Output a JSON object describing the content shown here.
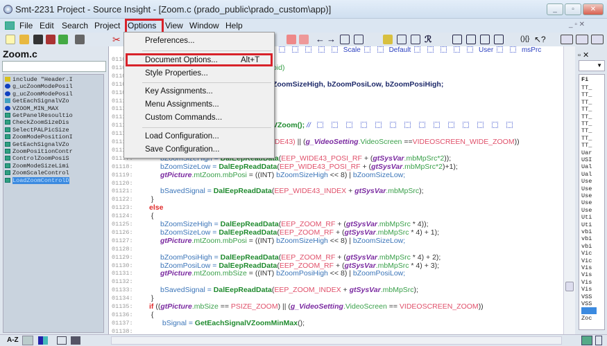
{
  "window": {
    "title": "Smt-2231 Project - Source Insight - [Zoom.c (prado_public\\prado_custom\\app)]",
    "minimize": "_",
    "restore": "▫",
    "close": "✕"
  },
  "menubar": {
    "items": [
      "File",
      "Edit",
      "Search",
      "Project",
      "Options",
      "View",
      "Window",
      "Help"
    ],
    "highlighted": "Options",
    "highlight_color": "#d8222a"
  },
  "options_menu": {
    "items": [
      {
        "label": "Preferences...",
        "shortcut": ""
      },
      {
        "label": "Document Options...",
        "shortcut": "Alt+T",
        "highlighted": true
      },
      {
        "label": "Style Properties...",
        "shortcut": ""
      },
      {
        "label": "Key Assignments...",
        "shortcut": ""
      },
      {
        "label": "Menu Assignments...",
        "shortcut": ""
      },
      {
        "label": "Custom Commands...",
        "shortcut": ""
      },
      {
        "label": "Load Configuration...",
        "shortcut": ""
      },
      {
        "label": "Save Configuration...",
        "shortcut": ""
      }
    ]
  },
  "symbol_bar": {
    "labels": [
      "Scale",
      "Default",
      "User",
      "msPrc"
    ]
  },
  "left_panel": {
    "file_name": "Zoom.c",
    "search_value": "",
    "symbols": [
      {
        "name": "include \"Header.I",
        "icon": "include-icon"
      },
      {
        "name": "g_ucZoomModePosil",
        "icon": "variable-icon"
      },
      {
        "name": "g_ucZoomModePosil",
        "icon": "variable-icon"
      },
      {
        "name": "GetEachSignalVZo",
        "icon": "prototype-icon"
      },
      {
        "name": "VZOOM_MIN_MAX",
        "icon": "variable-icon"
      },
      {
        "name": "GetPanelResoultio",
        "icon": "function-icon"
      },
      {
        "name": "CheckZoomSizeDis",
        "icon": "function-icon"
      },
      {
        "name": "SelectPALPicSize",
        "icon": "function-icon"
      },
      {
        "name": "ZoomModePositionI",
        "icon": "function-icon"
      },
      {
        "name": "GetEachSignalVZo",
        "icon": "function-icon"
      },
      {
        "name": "ZoomPositionContr",
        "icon": "function-icon"
      },
      {
        "name": "ControlZoomPosiS",
        "icon": "function-icon"
      },
      {
        "name": "ZoomModeSizeLimi",
        "icon": "function-icon"
      },
      {
        "name": "ZoomScaleControl",
        "icon": "function-icon"
      },
      {
        "name": "LoadZoomControlD",
        "icon": "function-icon",
        "selected": true
      }
    ],
    "sort_label": "A-Z"
  },
  "code": {
    "lines": [
      {
        "n": "01105:",
        "segs": []
      },
      {
        "n": "01106:",
        "partial": true,
        "segs": [
          [
            "m",
            "oid)"
          ]
        ]
      },
      {
        "n": "01107:",
        "segs": []
      },
      {
        "n": "01108:",
        "partial": true,
        "segs": [
          [
            "b",
            "ZoomSizeHigh, bZoomPosiLow, bZoomPosiHigh;"
          ]
        ]
      },
      {
        "n": "01109:",
        "segs": []
      },
      {
        "n": "01110:",
        "segs": []
      },
      {
        "n": "01111:",
        "segs": []
      },
      {
        "n": "01112:",
        "segs": []
      },
      {
        "n": "01113:",
        "partial": true,
        "segs": [
          [
            "f",
            "VZoom(); "
          ],
          [
            "cm",
            "// "
          ]
        ],
        "comment_glyphs": 14
      },
      {
        "n": "01114:",
        "segs": []
      },
      {
        "n": "01115:",
        "partial": true,
        "segs": [
          [
            "c",
            "IDE43)"
          ],
          [
            "p",
            " || ("
          ],
          [
            "g",
            "g_VideoSetting"
          ],
          [
            "m",
            ".VideoScreen "
          ],
          [
            "p",
            "=="
          ],
          [
            "c",
            "VIDEOSCREEN_WIDE_ZOOM"
          ],
          [
            "p",
            "))"
          ]
        ]
      },
      {
        "n": "01116:",
        "segs": []
      },
      {
        "n": "01117:",
        "indent": 1,
        "segs": [
          [
            "v",
            "bZoomSizeHigh = "
          ],
          [
            "f",
            "DalEepReadData"
          ],
          [
            "p",
            "("
          ],
          [
            "c",
            "EEP_WIDE43_POSI_RF"
          ],
          [
            "p",
            " + ("
          ],
          [
            "g",
            "gtSysVar"
          ],
          [
            "m",
            ".mbMpSrc*2"
          ],
          [
            "p",
            "));"
          ]
        ]
      },
      {
        "n": "01118:",
        "indent": 1,
        "segs": [
          [
            "v",
            "bZoomSizeLow = "
          ],
          [
            "f",
            "DalEepReadData"
          ],
          [
            "p",
            "("
          ],
          [
            "c",
            "EEP_WIDE43_POSI_RF"
          ],
          [
            "p",
            " + ("
          ],
          [
            "g",
            "gtSysVar"
          ],
          [
            "m",
            ".mbMpSrc*2"
          ],
          [
            "p",
            ")+1);"
          ]
        ]
      },
      {
        "n": "01119:",
        "indent": 1,
        "segs": [
          [
            "g",
            "gtPicture"
          ],
          [
            "m",
            ".mtZoom.mbPosi"
          ],
          [
            "p",
            " = ((INT) "
          ],
          [
            "v",
            "bZoomSizeHigh"
          ],
          [
            "p",
            " << 8) | "
          ],
          [
            "v",
            "bZoomSizeLow;"
          ]
        ]
      },
      {
        "n": "01120:",
        "segs": []
      },
      {
        "n": "01121:",
        "indent": 1,
        "segs": [
          [
            "v",
            "bSavedSignal = "
          ],
          [
            "f",
            "DalEepReadData"
          ],
          [
            "p",
            "("
          ],
          [
            "c",
            "EEP_WIDE43_INDEX"
          ],
          [
            "p",
            " + "
          ],
          [
            "g",
            "gtSysVar"
          ],
          [
            "m",
            ".mbMpSrc"
          ],
          [
            "p",
            ");"
          ]
        ]
      },
      {
        "n": "01122:",
        "indent": 0,
        "segs": [
          [
            "p",
            " }"
          ]
        ]
      },
      {
        "n": "01123:",
        "indent": 0,
        "segs": [
          [
            "k",
            "else"
          ]
        ]
      },
      {
        "n": "01124:",
        "indent": 0,
        "segs": [
          [
            "p",
            " {"
          ]
        ]
      },
      {
        "n": "01125:",
        "indent": 1,
        "segs": [
          [
            "v",
            "bZoomSizeHigh = "
          ],
          [
            "f",
            "DalEepReadData"
          ],
          [
            "p",
            "("
          ],
          [
            "c",
            "EEP_ZOOM_RF"
          ],
          [
            "p",
            " + ("
          ],
          [
            "g",
            "gtSysVar"
          ],
          [
            "m",
            ".mbMpSrc"
          ],
          [
            "p",
            " * 4));"
          ]
        ]
      },
      {
        "n": "01126:",
        "indent": 1,
        "segs": [
          [
            "v",
            "bZoomSizeLow = "
          ],
          [
            "f",
            "DalEepReadData"
          ],
          [
            "p",
            "("
          ],
          [
            "c",
            "EEP_ZOOM_RF"
          ],
          [
            "p",
            " + ("
          ],
          [
            "g",
            "gtSysVar"
          ],
          [
            "m",
            ".mbMpSrc"
          ],
          [
            "p",
            " * 4) + 1);"
          ]
        ]
      },
      {
        "n": "01127:",
        "indent": 1,
        "segs": [
          [
            "g",
            "gtPicture"
          ],
          [
            "m",
            ".mtZoom.mbPosi"
          ],
          [
            "p",
            " = ((INT) "
          ],
          [
            "v",
            "bZoomSizeHigh"
          ],
          [
            "p",
            " << 8) | "
          ],
          [
            "v",
            "bZoomSizeLow;"
          ]
        ]
      },
      {
        "n": "01128:",
        "segs": []
      },
      {
        "n": "01129:",
        "indent": 1,
        "segs": [
          [
            "v",
            "bZoomPosiHigh = "
          ],
          [
            "f",
            "DalEepReadData"
          ],
          [
            "p",
            "("
          ],
          [
            "c",
            "EEP_ZOOM_RF"
          ],
          [
            "p",
            " + ("
          ],
          [
            "g",
            "gtSysVar"
          ],
          [
            "m",
            ".mbMpSrc"
          ],
          [
            "p",
            " * 4) + 2);"
          ]
        ]
      },
      {
        "n": "01130:",
        "indent": 1,
        "segs": [
          [
            "v",
            "bZoomPosiLow = "
          ],
          [
            "f",
            "DalEepReadData"
          ],
          [
            "p",
            "("
          ],
          [
            "c",
            "EEP_ZOOM_RF"
          ],
          [
            "p",
            " + ("
          ],
          [
            "g",
            "gtSysVar"
          ],
          [
            "m",
            ".mbMpSrc"
          ],
          [
            "p",
            " * 4) + 3);"
          ]
        ]
      },
      {
        "n": "01131:",
        "indent": 1,
        "segs": [
          [
            "g",
            "gtPicture"
          ],
          [
            "m",
            ".mtZoom.mbSize"
          ],
          [
            "p",
            " = ((INT) "
          ],
          [
            "v",
            "bZoomPosiHigh"
          ],
          [
            "p",
            " << 8) | "
          ],
          [
            "v",
            "bZoomPosiLow;"
          ]
        ]
      },
      {
        "n": "01132:",
        "segs": []
      },
      {
        "n": "01133:",
        "indent": 1,
        "segs": [
          [
            "v",
            "bSavedSignal = "
          ],
          [
            "f",
            "DalEepReadData"
          ],
          [
            "p",
            "("
          ],
          [
            "c",
            "EEP_ZOOM_INDEX"
          ],
          [
            "p",
            " + "
          ],
          [
            "g",
            "gtSysVar"
          ],
          [
            "m",
            ".mbMpSrc"
          ],
          [
            "p",
            ");"
          ]
        ]
      },
      {
        "n": "01134:",
        "indent": 0,
        "segs": [
          [
            "p",
            " }"
          ]
        ]
      },
      {
        "n": "01135:",
        "indent": 0,
        "segs": [
          [
            "k",
            "if"
          ],
          [
            "p",
            " (("
          ],
          [
            "g",
            "gtPicture"
          ],
          [
            "m",
            ".mbSize"
          ],
          [
            "p",
            " == "
          ],
          [
            "c",
            "PSIZE_ZOOM"
          ],
          [
            "p",
            ") || ("
          ],
          [
            "g",
            "g_VideoSetting"
          ],
          [
            "m",
            ".VideoScreen"
          ],
          [
            "p",
            " == "
          ],
          [
            "c",
            "VIDEOSCREEN_ZOOM"
          ],
          [
            "p",
            "))"
          ]
        ]
      },
      {
        "n": "01136:",
        "indent": 0,
        "segs": [
          [
            "p",
            " {"
          ]
        ]
      },
      {
        "n": "01137:",
        "indent": 1,
        "segs": [
          [
            "v",
            " bSignal = "
          ],
          [
            "f",
            "GetEachSignalVZoomMinMax"
          ],
          [
            "p",
            "();"
          ]
        ]
      },
      {
        "n": "01138:",
        "segs": []
      }
    ]
  },
  "right_panel": {
    "header": "Fi",
    "items": [
      "TT_",
      "TT_",
      "TT_",
      "TT_",
      "TT_",
      "TT_",
      "TT_",
      "TT_",
      "TT_",
      "Uar",
      "USI",
      "Ual",
      "Ual",
      "Use",
      "Use",
      "Use",
      "Use",
      "Use",
      "Uti",
      "Uti",
      "vbi",
      "vbi",
      "vbi",
      "Vic",
      "Vic",
      "Vis",
      "Vis",
      "Vis",
      "Vis",
      "VSS",
      "VSS",
      "",
      "Zoc"
    ],
    "selected_index": 31
  }
}
